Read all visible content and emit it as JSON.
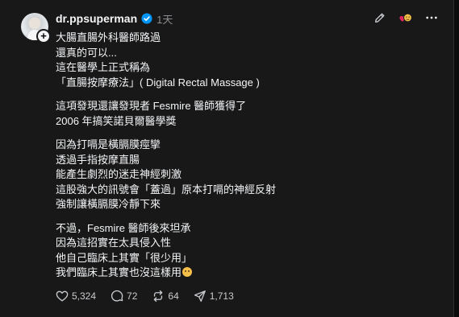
{
  "post": {
    "author": {
      "username": "dr.ppsuperman",
      "timestamp": "1天"
    },
    "paragraphs": [
      [
        "大腸直腸外科醫師路過",
        "還真的可以...",
        "這在醫學上正式稱為",
        "「直腸按摩療法」( Digital Rectal Massage )"
      ],
      [
        "這項發現還讓發現者 Fesmire 醫師獲得了",
        "2006 年搞笑諾貝爾醫學獎"
      ],
      [
        "因為打嗝是橫膈膜痙攣",
        "透過手指按摩直腸",
        "能產生劇烈的迷走神經刺激",
        "這股強大的訊號會「蓋過」原本打嗝的神經反射",
        "強制讓橫膈膜冷靜下來"
      ],
      [
        "不過，Fesmire 醫師後來坦承",
        "因為這招實在太具侵入性",
        "他自己臨床上其實「很少用」",
        "我們臨床上其實也沒這樣用"
      ]
    ],
    "stats": {
      "likes": "5,324",
      "replies": "72",
      "reposts": "64",
      "shares": "1,713"
    }
  },
  "icons": {
    "verified": "verified-badge-icon",
    "edit": "edit-pencil-icon",
    "reactions": "reaction-emoji-icon",
    "more": "more-options-icon",
    "like": "heart-icon",
    "reply": "comment-icon",
    "repost": "repost-icon",
    "share": "share-icon"
  },
  "colors": {
    "background": "#181818",
    "text": "#f3f5f7",
    "muted": "#8a8d91",
    "verified": "#0095f6"
  }
}
